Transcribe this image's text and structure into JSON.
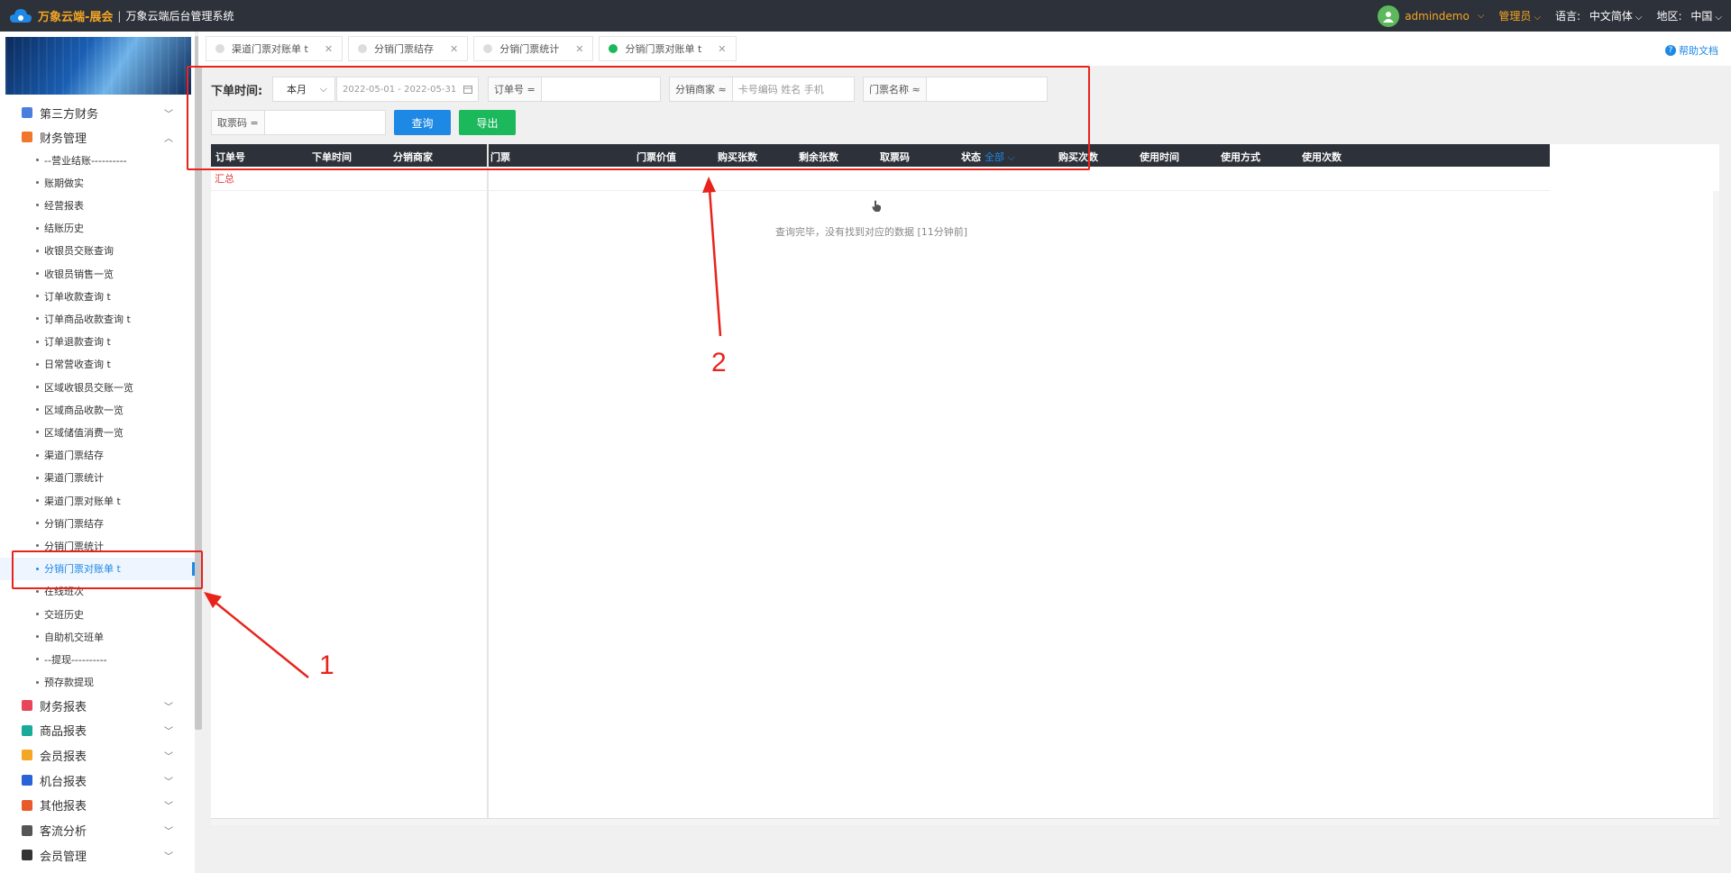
{
  "topbar": {
    "brand": "万象云端-展会",
    "separator": "|",
    "subtitle": "万象云端后台管理系统",
    "username": "admindemo",
    "role": "管理员",
    "language_label": "语言:",
    "language_value": "中文简体",
    "region_label": "地区:",
    "region_value": "中国"
  },
  "sidebar": {
    "groups_top": [
      {
        "label": "第三方财务",
        "color": "#4a7fe0"
      },
      {
        "label": "财务管理",
        "color": "#f0772a"
      }
    ],
    "items": [
      "--营业结账----------",
      "账期做实",
      "经营报表",
      "结账历史",
      "收银员交账查询",
      "收银员销售一览",
      "订单收款查询 t",
      "订单商品收款查询 t",
      "订单退款查询 t",
      "日常营收查询 t",
      "区域收银员交账一览",
      "区域商品收款一览",
      "区域储值消费一览",
      "渠道门票结存",
      "渠道门票统计",
      "渠道门票对账单 t",
      "分销门票结存",
      "分销门票统计",
      "分销门票对账单 t",
      "在线班次",
      "交班历史",
      "自助机交班单",
      "--提现----------",
      "预存款提现"
    ],
    "active_index": 18,
    "groups_bottom": [
      {
        "label": "财务报表",
        "color": "#e8455a"
      },
      {
        "label": "商品报表",
        "color": "#1aaa9a"
      },
      {
        "label": "会员报表",
        "color": "#f5a623"
      },
      {
        "label": "机台报表",
        "color": "#2a62d8"
      },
      {
        "label": "其他报表",
        "color": "#e85a2a"
      },
      {
        "label": "客流分析",
        "color": "#555555"
      },
      {
        "label": "会员管理",
        "color": "#333333"
      }
    ]
  },
  "tabs": [
    {
      "label": "渠道门票对账单 t",
      "close": "✕",
      "active": false
    },
    {
      "label": "分销门票结存",
      "close": "✕",
      "active": false
    },
    {
      "label": "分销门票统计",
      "close": "✕",
      "active": false
    },
    {
      "label": "分销门票对账单 t",
      "close": "✕",
      "active": true
    }
  ],
  "help": {
    "label": "帮助文档",
    "icon": "?"
  },
  "filters": {
    "order_time_label": "下单时间:",
    "period": "本月",
    "date_range": "2022-05-01 - 2022-05-31",
    "order_no_label": "订单号 =",
    "order_no_value": "",
    "distributor_label": "分销商家 ≈",
    "distributor_placeholder": "卡号编码 姓名 手机",
    "ticket_name_label": "门票名称 ≈",
    "ticket_name_value": "",
    "pickup_code_label": "取票码 =",
    "pickup_code_value": "",
    "query_button": "查询",
    "export_button": "导出"
  },
  "table": {
    "columns": [
      "订单号",
      "下单时间",
      "分销商家",
      "门票",
      "门票价值",
      "购买张数",
      "剩余张数",
      "取票码",
      "状态",
      "购买次数",
      "使用时间",
      "使用方式",
      "使用次数"
    ],
    "status_filter": "全部",
    "summary_label": "汇总",
    "empty_message": "查询完毕，没有找到对应的数据 [11分钟前]"
  },
  "annotations": {
    "marker1": "1",
    "marker2": "2",
    "color": "#e8231c"
  }
}
